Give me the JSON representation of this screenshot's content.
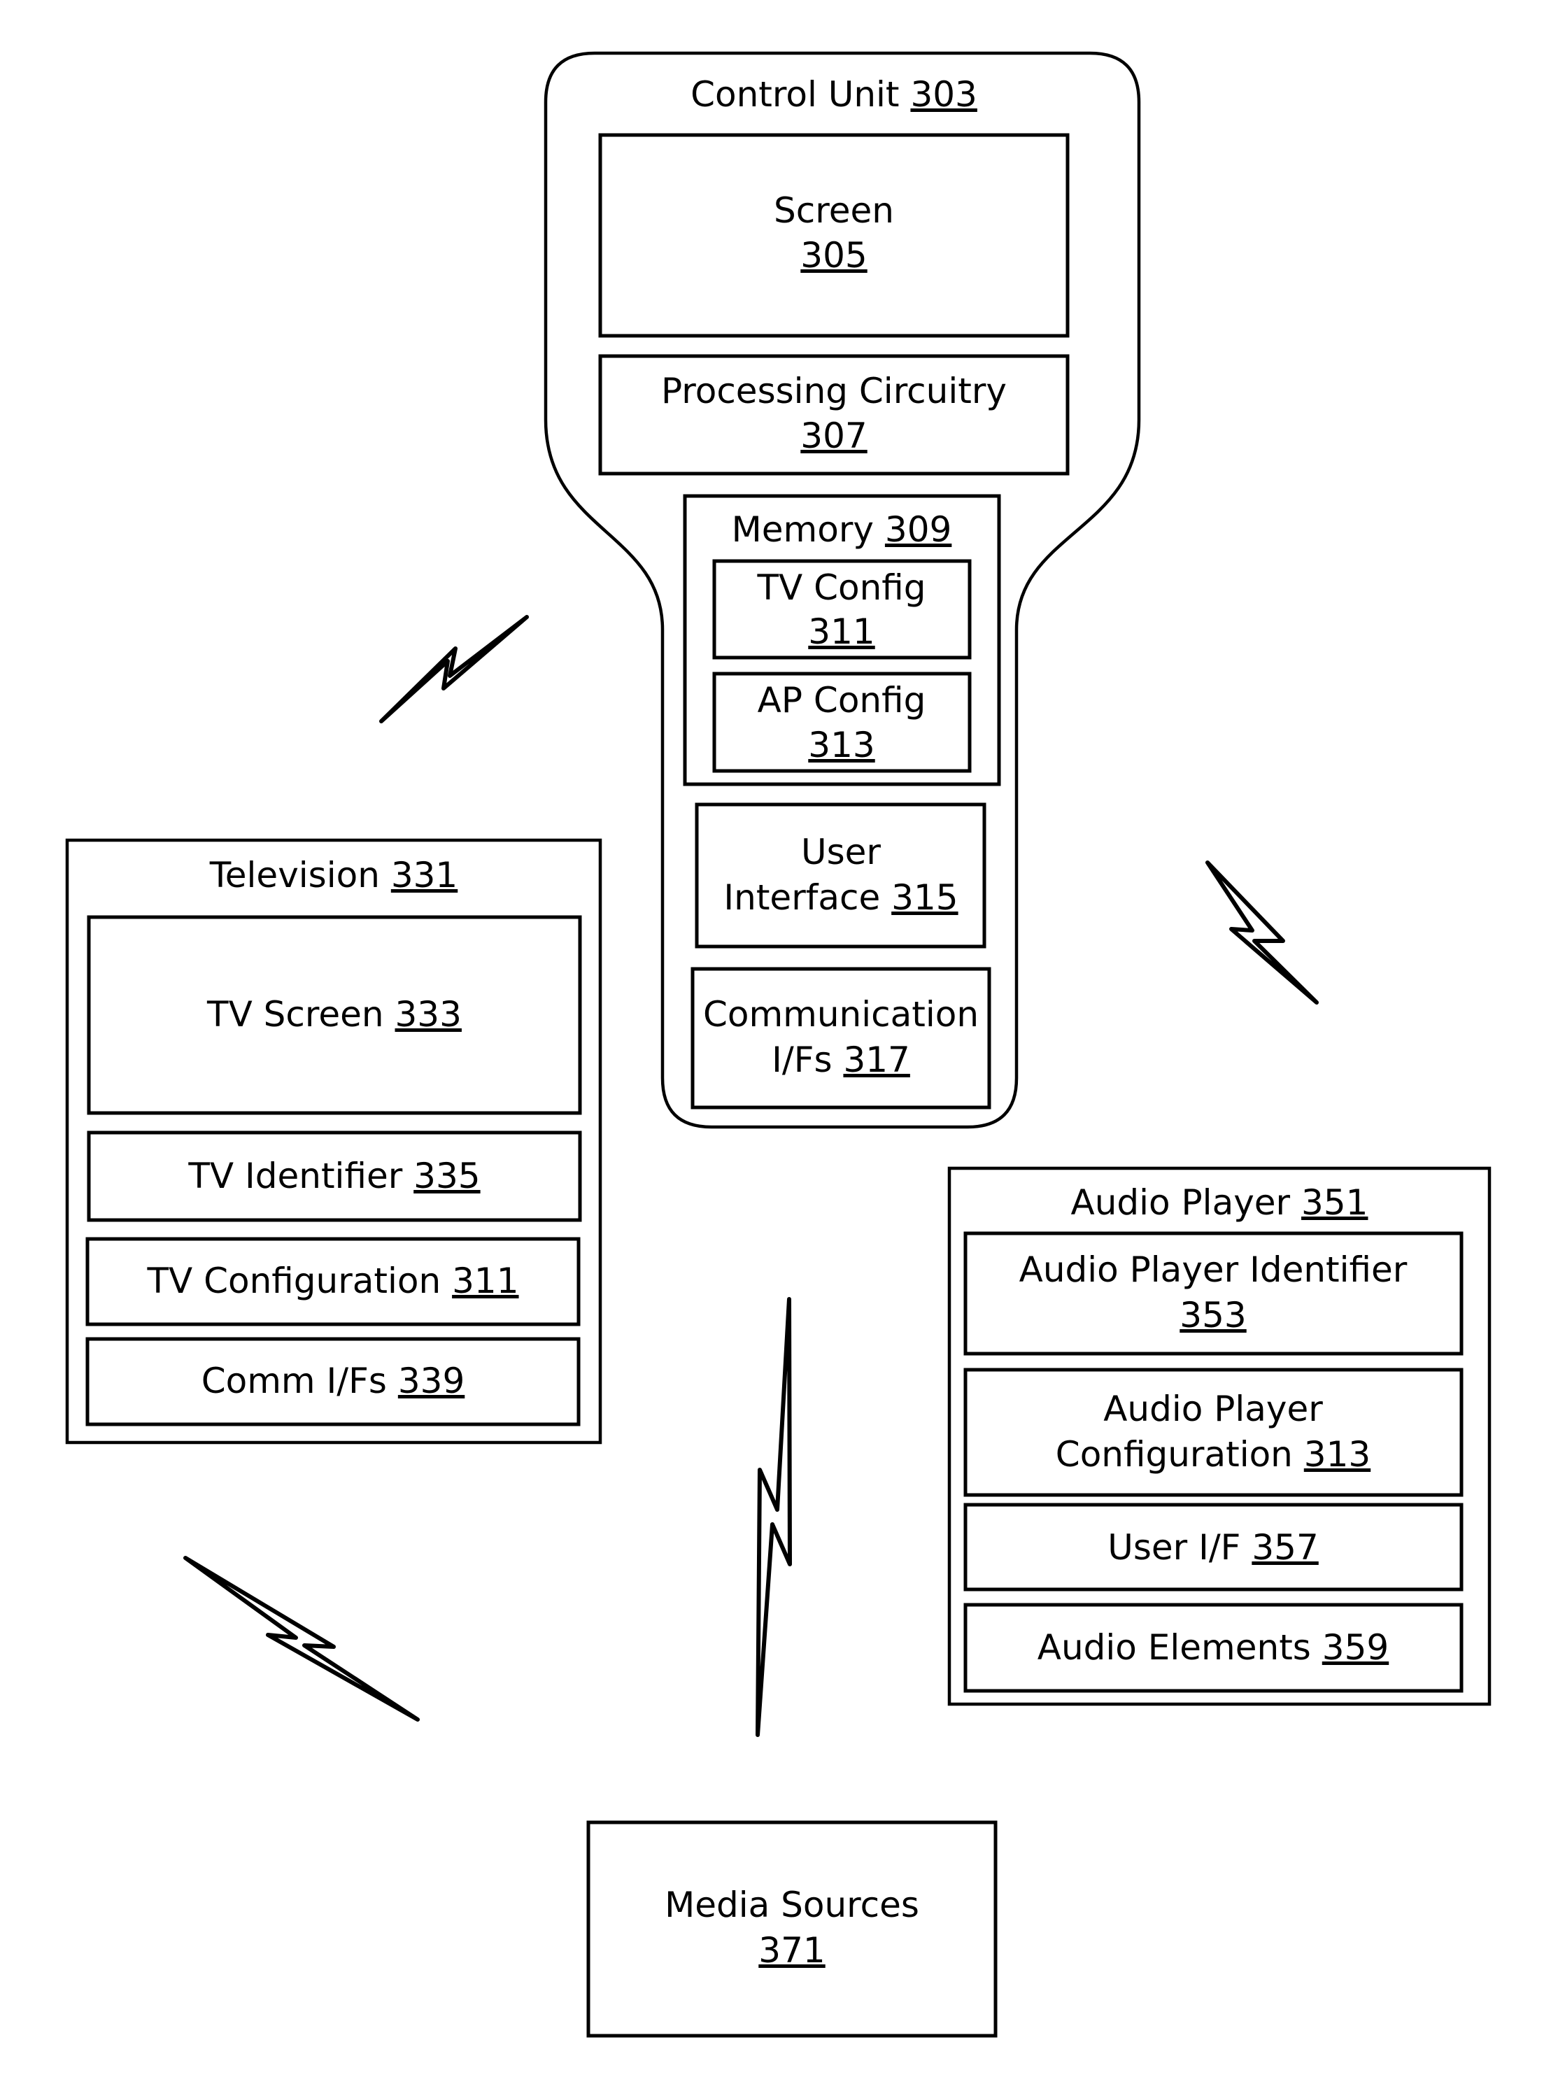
{
  "diagram": {
    "control_unit": {
      "label": "Control Unit",
      "ref": "303",
      "screen": {
        "label": "Screen",
        "ref": "305"
      },
      "processing": {
        "label": "Processing Circuitry",
        "ref": "307"
      },
      "memory": {
        "label": "Memory",
        "ref": "309",
        "tv_config": {
          "label": "TV Config",
          "ref": "311"
        },
        "ap_config": {
          "label": "AP Config",
          "ref": "313"
        }
      },
      "user_interface": {
        "line1": "User",
        "label": "Interface",
        "ref": "315"
      },
      "comm": {
        "line1": "Communication",
        "label": "I/Fs",
        "ref": "317"
      }
    },
    "television": {
      "label": "Television",
      "ref": "331",
      "screen": {
        "label": "TV Screen",
        "ref": "333"
      },
      "identifier": {
        "label": "TV Identifier",
        "ref": "335"
      },
      "configuration": {
        "label": "TV Configuration",
        "ref": "311"
      },
      "comm": {
        "label": "Comm I/Fs",
        "ref": "339"
      }
    },
    "audio_player": {
      "label": "Audio Player",
      "ref": "351",
      "identifier": {
        "line1": "Audio Player Identifier",
        "ref": "353"
      },
      "configuration": {
        "line1": "Audio Player",
        "label": "Configuration",
        "ref": "313"
      },
      "user_if": {
        "label": "User I/F",
        "ref": "357"
      },
      "elements": {
        "label": "Audio Elements",
        "ref": "359"
      }
    },
    "media_sources": {
      "label": "Media Sources",
      "ref": "371"
    },
    "wireless_links": [
      {
        "name": "control-unit-to-television",
        "icon": "lightning-bolt-icon"
      },
      {
        "name": "control-unit-to-audio-player",
        "icon": "lightning-bolt-icon"
      },
      {
        "name": "media-sources-link",
        "icon": "lightning-bolt-icon"
      },
      {
        "name": "television-to-media-sources",
        "icon": "lightning-bolt-icon"
      }
    ]
  }
}
